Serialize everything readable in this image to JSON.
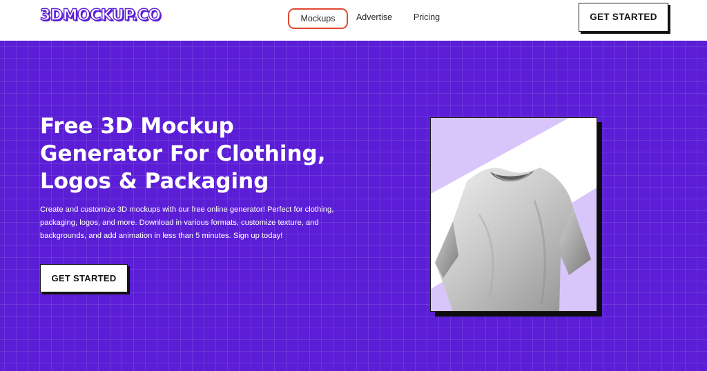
{
  "header": {
    "logo": "3DMOCKUP.CO",
    "nav": [
      {
        "label": "Mockups",
        "active": true
      },
      {
        "label": "Advertise",
        "active": false
      },
      {
        "label": "Pricing",
        "active": false
      }
    ],
    "cta_label": "GET STARTED"
  },
  "hero": {
    "title_lines": [
      "Free 3D Mockup",
      "Generator For Clothing,",
      "Logos & Packaging"
    ],
    "description_lines": [
      "Create and customize 3D mockups with our free online generator! Perfect for clothing,",
      "packaging, logos, and more. Download in various formats, customize texture, and",
      "backgrounds, and add animation in less than 5 minutes. Sign up today!"
    ],
    "cta_label": "GET STARTED"
  },
  "colors": {
    "brand_purple": "#5b1ed6",
    "lavender": "#d8c6fb",
    "nav_active_border": "#e0482f"
  },
  "icons": {
    "mockup_image": "tshirt-mockup-image"
  }
}
